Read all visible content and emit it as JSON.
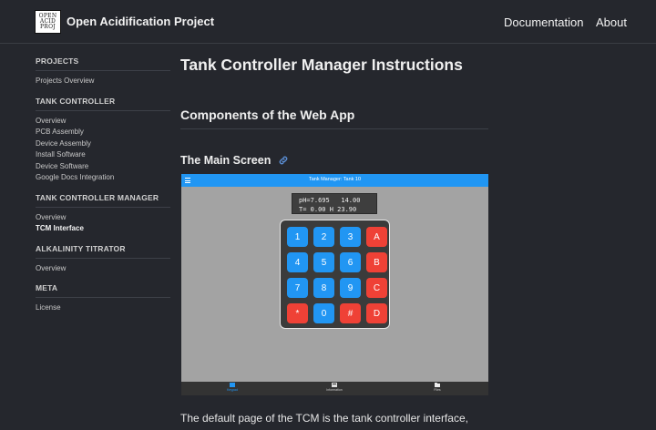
{
  "header": {
    "logo_lines": [
      "OPEN",
      "ACID",
      "PROJ"
    ],
    "site_title": "Open Acidification Project",
    "nav": [
      "Documentation",
      "About"
    ]
  },
  "sidebar": {
    "sections": [
      {
        "heading": "PROJECTS",
        "items": [
          "Projects Overview"
        ]
      },
      {
        "heading": "TANK CONTROLLER",
        "items": [
          "Overview",
          "PCB Assembly",
          "Device Assembly",
          "Install Software",
          "Device Software",
          "Google Docs Integration"
        ]
      },
      {
        "heading": "TANK CONTROLLER MANAGER",
        "items": [
          "Overview",
          "TCM Interface"
        ]
      },
      {
        "heading": "ALKALINITY TITRATOR",
        "items": [
          "Overview"
        ]
      },
      {
        "heading": "META",
        "items": [
          "License"
        ]
      }
    ],
    "active": "TCM Interface"
  },
  "content": {
    "title": "Tank Controller Manager Instructions",
    "h2": "Components of the Web App",
    "h3": "The Main Screen",
    "paragraph": "The default page of the TCM is the tank controller interface,"
  },
  "app": {
    "bar_title": "Tank Manager: Tank 10",
    "lcd_line1": "pH=7.695   14.00",
    "lcd_line2": "T= 0.00 H 23.90",
    "keys": [
      [
        "1",
        "2",
        "3",
        "A"
      ],
      [
        "4",
        "5",
        "6",
        "B"
      ],
      [
        "7",
        "8",
        "9",
        "C"
      ],
      [
        "*",
        "0",
        "#",
        "D"
      ]
    ],
    "tabs": [
      "Keypad",
      "Information",
      "Files"
    ],
    "active_tab": "Keypad",
    "colors": {
      "bar": "#2196f3",
      "digit_key": "#2196f3",
      "letter_key": "#ef4136"
    }
  }
}
